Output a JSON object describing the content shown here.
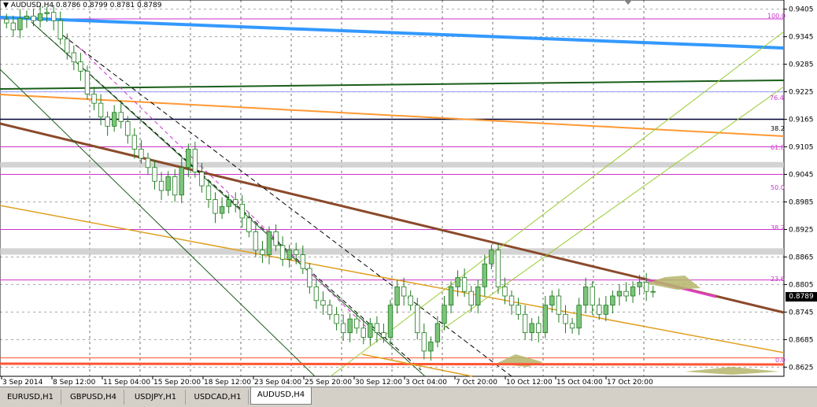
{
  "window": {
    "title_marker": "▼",
    "symbol_title": "AUDUSD,H4  0.8786 0.8799 0.8781 0.8789"
  },
  "price_axis": {
    "ticks": [
      "0.9405",
      "0.9345",
      "0.9285",
      "0.9225",
      "0.9165",
      "0.9105",
      "0.9045",
      "0.8985",
      "0.8925",
      "0.8865",
      "0.8805",
      "0.8745",
      "0.8685",
      "0.8625"
    ],
    "current_price": "0.8789"
  },
  "time_axis": {
    "ticks": [
      "3 Sep 2014",
      "8 Sep 12:00",
      "11 Sep 04:00",
      "15 Sep 20:00",
      "18 Sep 12:00",
      "23 Sep 04:00",
      "25 Sep 20:00",
      "30 Sep 12:00",
      "3 Oct 04:00",
      "7 Oct 20:00",
      "10 Oct 12:00",
      "15 Oct 04:00",
      "17 Oct 20:00"
    ]
  },
  "fib_labels": {
    "f100": "100.0",
    "f76": "76.4",
    "f38a": "38.2",
    "f61": "61.8",
    "f50": "50.0",
    "f38b": "38.2",
    "f23": "23.6",
    "f0": "0.0"
  },
  "tabs": [
    {
      "label": "EURUSD,H1",
      "active": false
    },
    {
      "label": "GBPUSD,H4",
      "active": false
    },
    {
      "label": "USDJPY,H1",
      "active": false
    },
    {
      "label": "USDCAD,H1",
      "active": false
    },
    {
      "label": "AUDUSD,H4",
      "active": true
    }
  ],
  "colors": {
    "bull_candle": "#7cc47c",
    "bear_candle": "#ffffff",
    "candle_outline": "#1f7a1f",
    "trend_blue": "#3399ff",
    "trend_brown": "#8b4a2b",
    "trend_orange": "#ff9933",
    "fib_magenta": "#cc33cc"
  },
  "chart_data": {
    "type": "candlestick",
    "symbol": "AUDUSD",
    "timeframe": "H4",
    "ohlc_last": {
      "open": 0.8786,
      "high": 0.8799,
      "low": 0.8781,
      "close": 0.8789
    },
    "y_range": [
      0.8605,
      0.9425
    ],
    "close_path": [
      0.9375,
      0.936,
      0.9385,
      0.939,
      0.938,
      0.9395,
      0.9398,
      0.938,
      0.934,
      0.931,
      0.929,
      0.927,
      0.922,
      0.92,
      0.917,
      0.915,
      0.918,
      0.916,
      0.913,
      0.91,
      0.908,
      0.906,
      0.903,
      0.901,
      0.904,
      0.9,
      0.906,
      0.91,
      0.905,
      0.902,
      0.899,
      0.896,
      0.8975,
      0.899,
      0.898,
      0.895,
      0.892,
      0.888,
      0.887,
      0.892,
      0.889,
      0.886,
      0.888,
      0.887,
      0.884,
      0.88,
      0.877,
      0.876,
      0.874,
      0.872,
      0.87,
      0.873,
      0.871,
      0.869,
      0.872,
      0.87,
      0.869,
      0.876,
      0.88,
      0.878,
      0.876,
      0.87,
      0.866,
      0.868,
      0.872,
      0.876,
      0.88,
      0.882,
      0.879,
      0.876,
      0.88,
      0.885,
      0.888,
      0.88,
      0.878,
      0.876,
      0.874,
      0.87,
      0.872,
      0.87,
      0.876,
      0.878,
      0.874,
      0.872,
      0.871,
      0.876,
      0.88,
      0.876,
      0.874,
      0.876,
      0.878,
      0.879,
      0.878,
      0.88,
      0.881,
      0.879,
      0.8789
    ],
    "horizontal_levels": [
      0.9225,
      0.9165,
      0.9105,
      0.9045,
      0.8925,
      0.8815,
      0.8645
    ],
    "grey_bands": [
      [
        0.906,
        0.9072
      ],
      [
        0.887,
        0.8884
      ]
    ]
  }
}
